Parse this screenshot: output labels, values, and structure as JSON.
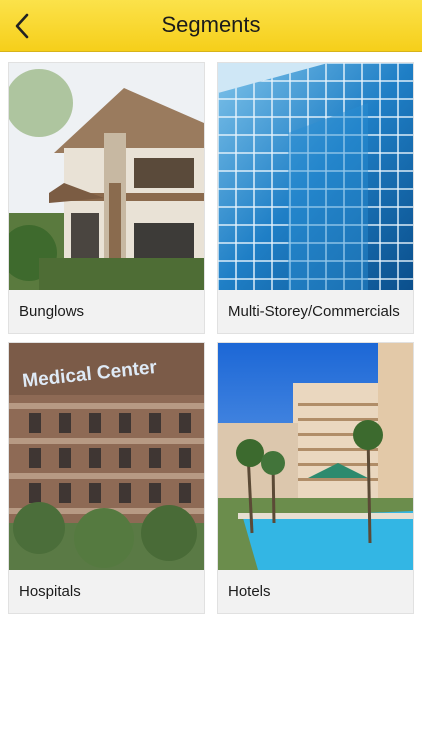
{
  "header": {
    "title": "Segments",
    "back_icon": "chevron-left-icon"
  },
  "segments": [
    {
      "label": "Bunglows"
    },
    {
      "label": "Multi-Storey/Commercials"
    },
    {
      "label": "Hospitals",
      "sign_text": "Medical Center"
    },
    {
      "label": "Hotels"
    }
  ]
}
